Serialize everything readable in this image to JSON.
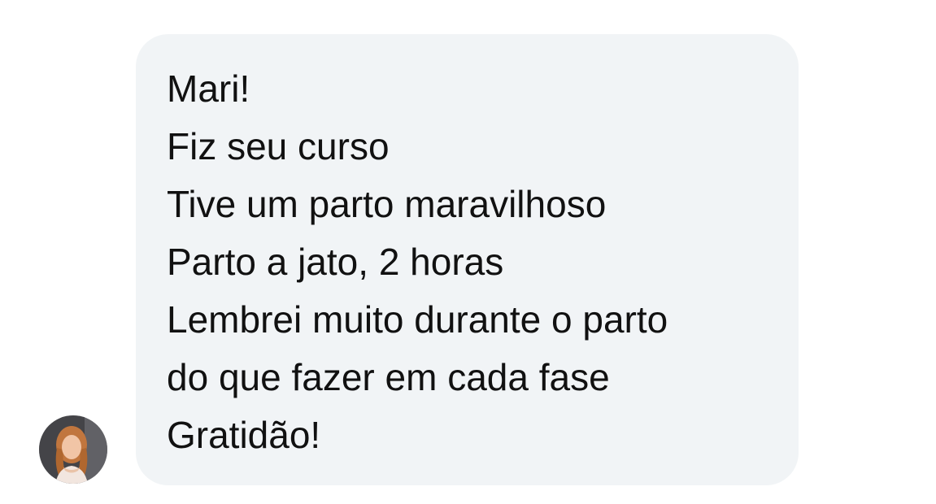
{
  "message": {
    "lines": [
      "Mari!",
      "Fiz seu curso",
      "Tive um parto maravilhoso",
      "Parto a jato, 2 horas",
      "Lembrei muito durante o parto",
      "do que fazer em cada fase",
      "Gratidão!"
    ]
  },
  "colors": {
    "bubble_background": "#f1f4f6",
    "text": "#111111",
    "page_background": "#ffffff"
  }
}
